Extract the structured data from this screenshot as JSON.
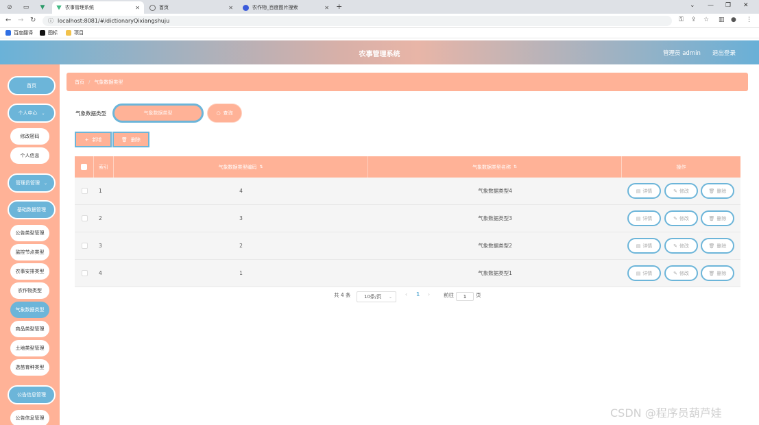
{
  "browser": {
    "tabs": [
      {
        "title": "农事管理系统",
        "active": true
      },
      {
        "title": "首页",
        "active": false
      },
      {
        "title": "农作物_百度图片搜索",
        "active": false
      }
    ],
    "new_tab": "+",
    "url": "localhost:8081/#/dictionaryQixiangshuju",
    "bookmarks": [
      "百度翻译",
      "图标",
      "项目"
    ]
  },
  "header": {
    "title": "农事管理系统",
    "user_label": "管理员 admin",
    "logout_label": "退出登录"
  },
  "sidebar": {
    "items": [
      {
        "label": "首页",
        "type": "main",
        "chevron": false
      },
      {
        "label": "个人中心",
        "type": "main",
        "chevron": true
      },
      {
        "label": "修改密码",
        "type": "sub"
      },
      {
        "label": "个人信息",
        "type": "sub"
      },
      {
        "label": "管理员管理",
        "type": "main",
        "chevron": true
      },
      {
        "label": "基础数据管理",
        "type": "main",
        "chevron": false
      },
      {
        "label": "公告类型管理",
        "type": "sub"
      },
      {
        "label": "监控节点类型",
        "type": "sub"
      },
      {
        "label": "农事安排类型",
        "type": "sub"
      },
      {
        "label": "农作物类型",
        "type": "sub"
      },
      {
        "label": "气象数据类型",
        "type": "sub",
        "active": true
      },
      {
        "label": "商品类型管理",
        "type": "sub"
      },
      {
        "label": "土地类型管理",
        "type": "sub"
      },
      {
        "label": "选苗育种类型",
        "type": "sub"
      },
      {
        "label": "公告信息管理",
        "type": "main",
        "chevron": false
      },
      {
        "label": "公告信息管理",
        "type": "sub"
      }
    ]
  },
  "breadcrumb": {
    "home": "首页",
    "separator": "/",
    "current": "气象数据类型"
  },
  "search": {
    "label": "气象数据类型",
    "placeholder": "气象数据类型",
    "query_label": "查询"
  },
  "actions": {
    "add_label": "新增",
    "delete_label": "删除"
  },
  "table": {
    "columns": [
      "索引",
      "气象数据类型编码",
      "气象数据类型名称",
      "操作"
    ],
    "rows": [
      {
        "index": "1",
        "code": "4",
        "name": "气象数据类型4"
      },
      {
        "index": "2",
        "code": "3",
        "name": "气象数据类型3"
      },
      {
        "index": "3",
        "code": "2",
        "name": "气象数据类型2"
      },
      {
        "index": "4",
        "code": "1",
        "name": "气象数据类型1"
      }
    ],
    "row_actions": {
      "detail": "详情",
      "edit": "修改",
      "delete": "删除"
    }
  },
  "pagination": {
    "total_text": "共 4 条",
    "page_size": "10条/页",
    "current_page": "1",
    "goto_label": "前往",
    "goto_value": "1",
    "page_suffix": "页"
  },
  "watermark": "CSDN @程序员葫芦娃",
  "colors": {
    "accent_blue": "#6cb5d9",
    "accent_salmon": "#ffb297"
  }
}
